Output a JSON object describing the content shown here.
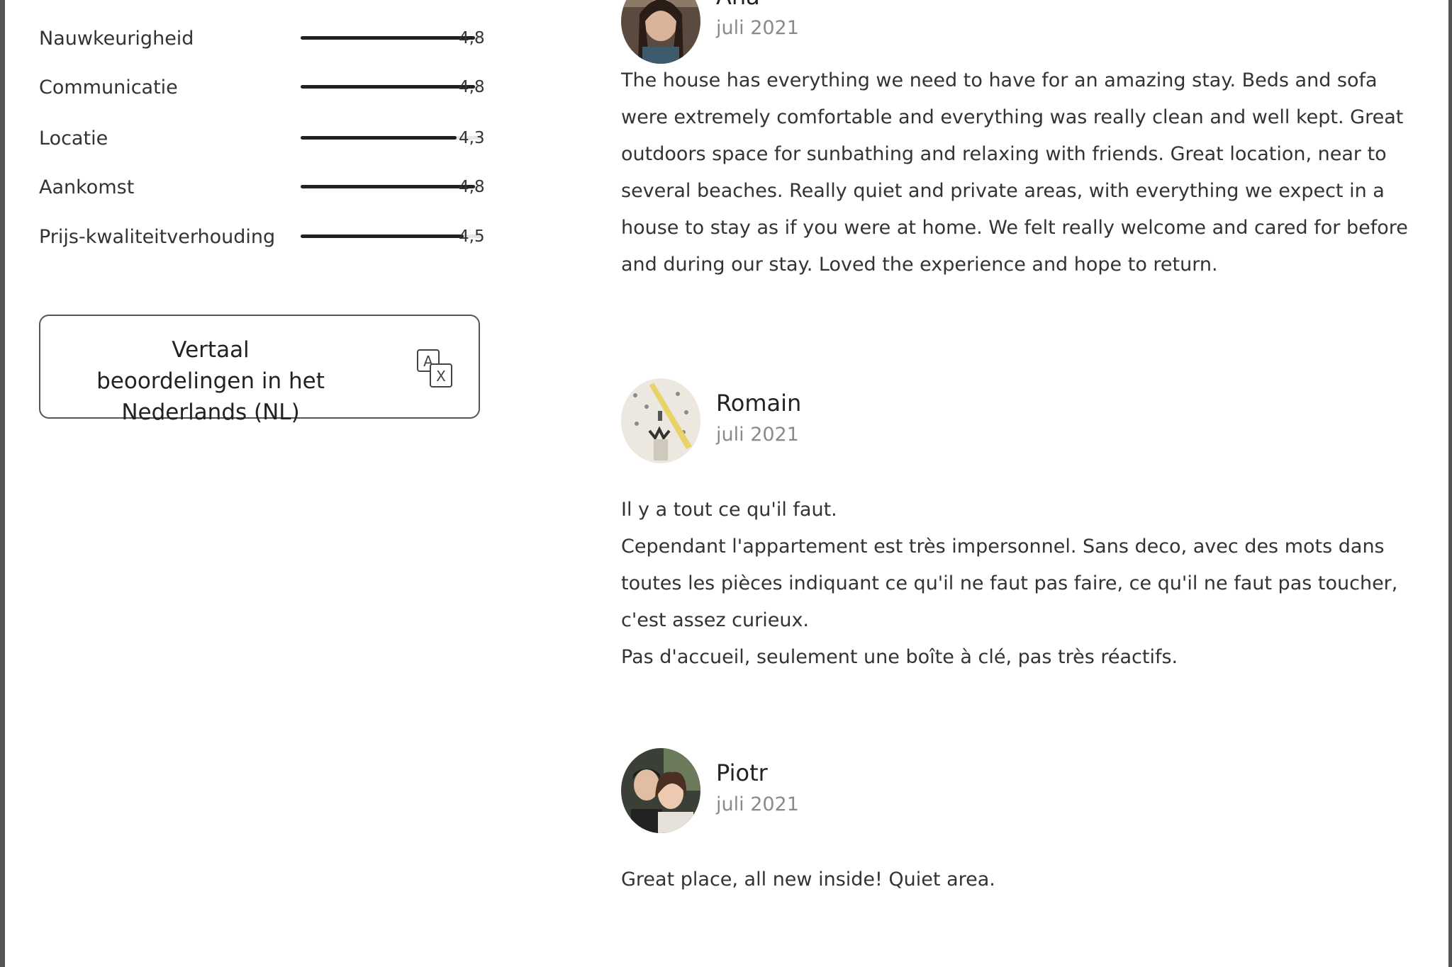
{
  "ratings": [
    {
      "label": "Nauwkeurigheid",
      "value": "4,8",
      "score": 4.8
    },
    {
      "label": "Communicatie",
      "value": "4,8",
      "score": 4.8
    },
    {
      "label": "Locatie",
      "value": "4,3",
      "score": 4.3
    },
    {
      "label": "Aankomst",
      "value": "4,8",
      "score": 4.8
    },
    {
      "label": "Prijs-kwaliteitverhouding",
      "value": "4,5",
      "score": 4.5
    }
  ],
  "translate_button": {
    "label": "Vertaal beoordelingen in het Nederlands (NL)",
    "icon": "translate-icon"
  },
  "reviews": [
    {
      "name": "Ana",
      "date": "juli 2021",
      "avatar": "avatar-photo",
      "paragraphs": [
        "The house has everything we need to have for an amazing stay. Beds and sofa were extremely comfortable and everything was really clean and well kept. Great outdoors space for sunbathing and relaxing with friends. Great location, near to several beaches. Really quiet and private areas, with everything we expect in a house to stay as if you were at home. We felt really welcome and cared for before and during our stay. Loved the experience and hope to return."
      ]
    },
    {
      "name": "Romain",
      "date": "juli 2021",
      "avatar": "avatar-photo",
      "paragraphs": [
        "Il y a tout ce qu'il faut.",
        "Cependant l'appartement est très impersonnel. Sans deco, avec des mots dans toutes les pièces indiquant ce qu'il ne faut pas faire, ce qu'il ne faut pas toucher, c'est assez curieux.",
        "Pas d'accueil, seulement une boîte à clé, pas très réactifs."
      ]
    },
    {
      "name": "Piotr",
      "date": "juli 2021",
      "avatar": "avatar-photo",
      "paragraphs": [
        "Great place, all new inside! Quiet area."
      ]
    }
  ],
  "colors": {
    "text": "#222222",
    "muted": "#8a8a8a",
    "bar_fill": "#222222",
    "bar_track": "#e6e6e6",
    "border": "#555555"
  }
}
